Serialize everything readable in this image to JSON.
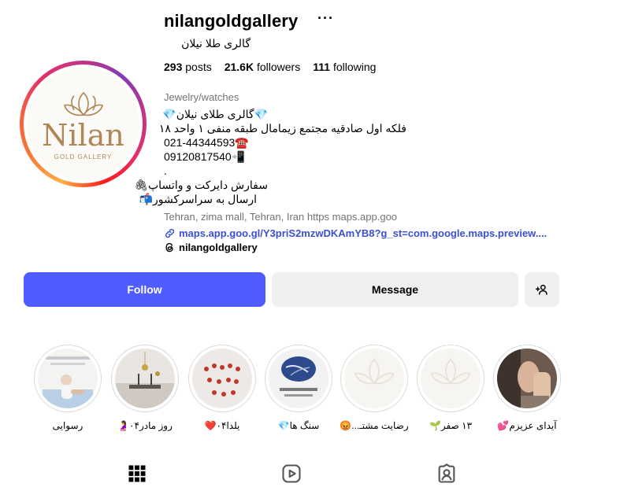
{
  "profile": {
    "username": "nilangoldgallery",
    "more_icon": "···",
    "full_name": "گالری طلا نیلان",
    "avatar_brand": "Nilan",
    "avatar_sub": "GOLD GALLERY"
  },
  "stats": {
    "posts_count": "293",
    "posts_label": "posts",
    "followers_count": "21.6K",
    "followers_label": "followers",
    "following_count": "111",
    "following_label": "following"
  },
  "bio": {
    "category": "Jewelry/watches",
    "line1": "💎گالری طلای نیلان💎",
    "line2": "فلکه اول صادقیه مجتمع زیمامال طبقه منفی ۱ واحد ۱۸",
    "line3": "021-44344593☎️",
    "line4": "09120817540📲",
    "line5": ".",
    "line6": "سفارش دایرکت و واتساپ🖇",
    "line7": "ارسال به سراسرکشور📬",
    "location": "Tehran, zima mall, Tehran, Iran https maps.app.goo",
    "link": "maps.app.goo.gl/Y3priS2mzwDKAmYB8?g_st=com.google.maps.preview....",
    "threads": "nilangoldgallery"
  },
  "actions": {
    "follow": "Follow",
    "message": "Message"
  },
  "highlights": [
    {
      "label": "رسوایی"
    },
    {
      "label": "روز مادر۰۴🤰"
    },
    {
      "label": "یلدا۰۴❤️"
    },
    {
      "label": "سنگ ها💎"
    },
    {
      "label": "رضایت مشتـ...😡"
    },
    {
      "label": "۱۳ صفر🌱"
    },
    {
      "label": "آیدای عزیزم💕"
    }
  ],
  "tabs": [
    {
      "icon": "grid-icon"
    },
    {
      "icon": "reels-icon"
    },
    {
      "icon": "tagged-icon"
    }
  ],
  "colors": {
    "follow_button": "#4f5cff",
    "link": "#3a4fd4",
    "secondary_text": "#737373",
    "brand_gold": "#b08656"
  }
}
